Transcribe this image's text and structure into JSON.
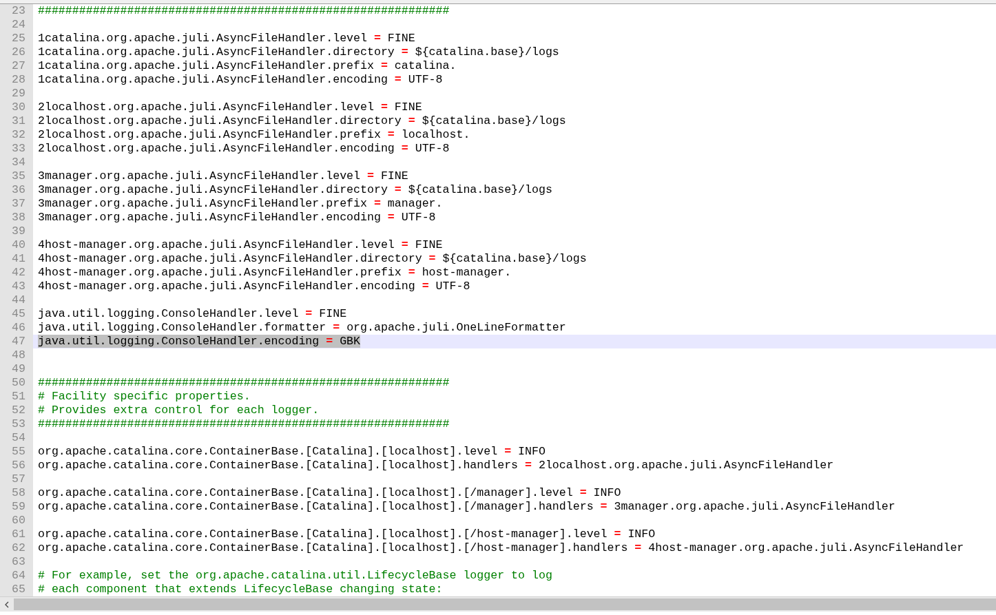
{
  "lines": [
    {
      "number": "23",
      "kind": "comment",
      "text": "############################################################",
      "selected": false
    },
    {
      "number": "24",
      "kind": "blank",
      "selected": false
    },
    {
      "number": "25",
      "kind": "property",
      "key": "1catalina.org.apache.juli.AsyncFileHandler.level",
      "operator": "=",
      "value": "FINE",
      "selected": false
    },
    {
      "number": "26",
      "kind": "property",
      "key": "1catalina.org.apache.juli.AsyncFileHandler.directory",
      "operator": "=",
      "value": "${catalina.base}/logs",
      "selected": false
    },
    {
      "number": "27",
      "kind": "property",
      "key": "1catalina.org.apache.juli.AsyncFileHandler.prefix",
      "operator": "=",
      "value": "catalina.",
      "selected": false
    },
    {
      "number": "28",
      "kind": "property",
      "key": "1catalina.org.apache.juli.AsyncFileHandler.encoding",
      "operator": "=",
      "value": "UTF-8",
      "selected": false
    },
    {
      "number": "29",
      "kind": "blank",
      "selected": false
    },
    {
      "number": "30",
      "kind": "property",
      "key": "2localhost.org.apache.juli.AsyncFileHandler.level",
      "operator": "=",
      "value": "FINE",
      "selected": false
    },
    {
      "number": "31",
      "kind": "property",
      "key": "2localhost.org.apache.juli.AsyncFileHandler.directory",
      "operator": "=",
      "value": "${catalina.base}/logs",
      "selected": false
    },
    {
      "number": "32",
      "kind": "property",
      "key": "2localhost.org.apache.juli.AsyncFileHandler.prefix",
      "operator": "=",
      "value": "localhost.",
      "selected": false
    },
    {
      "number": "33",
      "kind": "property",
      "key": "2localhost.org.apache.juli.AsyncFileHandler.encoding",
      "operator": "=",
      "value": "UTF-8",
      "selected": false
    },
    {
      "number": "34",
      "kind": "blank",
      "selected": false
    },
    {
      "number": "35",
      "kind": "property",
      "key": "3manager.org.apache.juli.AsyncFileHandler.level",
      "operator": "=",
      "value": "FINE",
      "selected": false
    },
    {
      "number": "36",
      "kind": "property",
      "key": "3manager.org.apache.juli.AsyncFileHandler.directory",
      "operator": "=",
      "value": "${catalina.base}/logs",
      "selected": false
    },
    {
      "number": "37",
      "kind": "property",
      "key": "3manager.org.apache.juli.AsyncFileHandler.prefix",
      "operator": "=",
      "value": "manager.",
      "selected": false
    },
    {
      "number": "38",
      "kind": "property",
      "key": "3manager.org.apache.juli.AsyncFileHandler.encoding",
      "operator": "=",
      "value": "UTF-8",
      "selected": false
    },
    {
      "number": "39",
      "kind": "blank",
      "selected": false
    },
    {
      "number": "40",
      "kind": "property",
      "key": "4host-manager.org.apache.juli.AsyncFileHandler.level",
      "operator": "=",
      "value": "FINE",
      "selected": false
    },
    {
      "number": "41",
      "kind": "property",
      "key": "4host-manager.org.apache.juli.AsyncFileHandler.directory",
      "operator": "=",
      "value": "${catalina.base}/logs",
      "selected": false
    },
    {
      "number": "42",
      "kind": "property",
      "key": "4host-manager.org.apache.juli.AsyncFileHandler.prefix",
      "operator": "=",
      "value": "host-manager.",
      "selected": false
    },
    {
      "number": "43",
      "kind": "property",
      "key": "4host-manager.org.apache.juli.AsyncFileHandler.encoding",
      "operator": "=",
      "value": "UTF-8",
      "selected": false
    },
    {
      "number": "44",
      "kind": "blank",
      "selected": false
    },
    {
      "number": "45",
      "kind": "property",
      "key": "java.util.logging.ConsoleHandler.level",
      "operator": "=",
      "value": "FINE",
      "selected": false
    },
    {
      "number": "46",
      "kind": "property",
      "key": "java.util.logging.ConsoleHandler.formatter",
      "operator": "=",
      "value": "org.apache.juli.OneLineFormatter",
      "selected": false
    },
    {
      "number": "47",
      "kind": "property",
      "key": "java.util.logging.ConsoleHandler.encoding",
      "operator": "=",
      "value": "GBK",
      "selected": true
    },
    {
      "number": "48",
      "kind": "blank",
      "selected": false
    },
    {
      "number": "49",
      "kind": "blank",
      "selected": false
    },
    {
      "number": "50",
      "kind": "comment",
      "text": "############################################################",
      "selected": false
    },
    {
      "number": "51",
      "kind": "comment",
      "text": "# Facility specific properties.",
      "selected": false
    },
    {
      "number": "52",
      "kind": "comment",
      "text": "# Provides extra control for each logger.",
      "selected": false
    },
    {
      "number": "53",
      "kind": "comment",
      "text": "############################################################",
      "selected": false
    },
    {
      "number": "54",
      "kind": "blank",
      "selected": false
    },
    {
      "number": "55",
      "kind": "property",
      "key": "org.apache.catalina.core.ContainerBase.[Catalina].[localhost].level",
      "operator": "=",
      "value": "INFO",
      "selected": false
    },
    {
      "number": "56",
      "kind": "property",
      "key": "org.apache.catalina.core.ContainerBase.[Catalina].[localhost].handlers",
      "operator": "=",
      "value": "2localhost.org.apache.juli.AsyncFileHandler",
      "selected": false
    },
    {
      "number": "57",
      "kind": "blank",
      "selected": false
    },
    {
      "number": "58",
      "kind": "property",
      "key": "org.apache.catalina.core.ContainerBase.[Catalina].[localhost].[/manager].level",
      "operator": "=",
      "value": "INFO",
      "selected": false
    },
    {
      "number": "59",
      "kind": "property",
      "key": "org.apache.catalina.core.ContainerBase.[Catalina].[localhost].[/manager].handlers",
      "operator": "=",
      "value": "3manager.org.apache.juli.AsyncFileHandler",
      "selected": false
    },
    {
      "number": "60",
      "kind": "blank",
      "selected": false
    },
    {
      "number": "61",
      "kind": "property",
      "key": "org.apache.catalina.core.ContainerBase.[Catalina].[localhost].[/host-manager].level",
      "operator": "=",
      "value": "INFO",
      "selected": false
    },
    {
      "number": "62",
      "kind": "property",
      "key": "org.apache.catalina.core.ContainerBase.[Catalina].[localhost].[/host-manager].handlers",
      "operator": "=",
      "value": "4host-manager.org.apache.juli.AsyncFileHandler",
      "selected": false
    },
    {
      "number": "63",
      "kind": "blank",
      "selected": false
    },
    {
      "number": "64",
      "kind": "comment",
      "text": "# For example, set the org.apache.catalina.util.LifecycleBase logger to log",
      "selected": false
    },
    {
      "number": "65",
      "kind": "comment",
      "text": "# each component that extends LifecycleBase changing state:",
      "selected": false
    }
  ]
}
